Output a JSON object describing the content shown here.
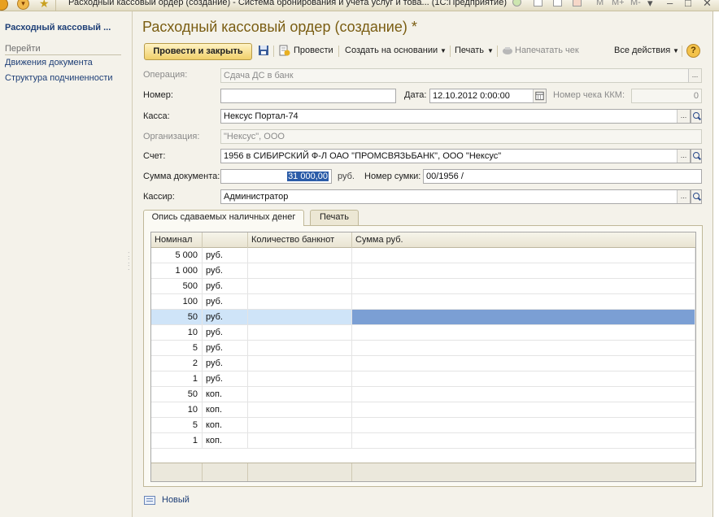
{
  "window": {
    "title": "Расходный кассовый ордер (создание) - Система бронирования и учета услуг и това... (1С:Предприятие)",
    "tool_letters": [
      "M",
      "M+",
      "M-"
    ]
  },
  "nav": {
    "title": "Расходный кассовый ...",
    "group": "Перейти",
    "links": [
      "Движения документа",
      "Структура подчиненности"
    ]
  },
  "form": {
    "title": "Расходный кассовый ордер (создание) *"
  },
  "toolbar": {
    "post_close": "Провести и закрыть",
    "post": "Провести",
    "create_based": "Создать на основании",
    "print": "Печать",
    "print_receipt": "Напечатать чек",
    "all_actions": "Все действия",
    "help": "?"
  },
  "fields": {
    "operation_label": "Операция:",
    "operation_value": "Сдача ДС в банк",
    "number_label": "Номер:",
    "number_value": "",
    "date_label": "Дата:",
    "date_value": "12.10.2012  0:00:00",
    "kkm_label": "Номер чека ККМ:",
    "kkm_value": "0",
    "kassa_label": "Касса:",
    "kassa_value": "Нексус Портал-74",
    "org_label": "Организация:",
    "org_value": "\"Нексус\", ООО",
    "account_label": "Счет:",
    "account_value": "1956 в СИБИРСКИЙ Ф-Л ОАО \"ПРОМСВЯЗЬБАНК\", ООО \"Нексус\"",
    "sum_label": "Сумма документа:",
    "sum_value": "31 000,00",
    "currency": "руб.",
    "bag_label": "Номер сумки:",
    "bag_value": "00/1956  /",
    "cashier_label": "Кассир:",
    "cashier_value": "Администратор"
  },
  "tabs": [
    "Опись сдаваемых наличных денег",
    "Печать"
  ],
  "table": {
    "headers": [
      "Номинал",
      "",
      "Количество банкнот",
      "Сумма руб."
    ],
    "rows": [
      {
        "nominal": "5 000",
        "unit": "руб.",
        "count": "",
        "sum": ""
      },
      {
        "nominal": "1 000",
        "unit": "руб.",
        "count": "",
        "sum": ""
      },
      {
        "nominal": "500",
        "unit": "руб.",
        "count": "",
        "sum": ""
      },
      {
        "nominal": "100",
        "unit": "руб.",
        "count": "",
        "sum": ""
      },
      {
        "nominal": "50",
        "unit": "руб.",
        "count": "",
        "sum": ""
      },
      {
        "nominal": "10",
        "unit": "руб.",
        "count": "",
        "sum": ""
      },
      {
        "nominal": "5",
        "unit": "руб.",
        "count": "",
        "sum": ""
      },
      {
        "nominal": "2",
        "unit": "руб.",
        "count": "",
        "sum": ""
      },
      {
        "nominal": "1",
        "unit": "руб.",
        "count": "",
        "sum": ""
      },
      {
        "nominal": "50",
        "unit": "коп.",
        "count": "",
        "sum": ""
      },
      {
        "nominal": "10",
        "unit": "коп.",
        "count": "",
        "sum": ""
      },
      {
        "nominal": "5",
        "unit": "коп.",
        "count": "",
        "sum": ""
      },
      {
        "nominal": "1",
        "unit": "коп.",
        "count": "",
        "sum": ""
      }
    ],
    "selected_row": 4
  },
  "bottom": {
    "new_label": "Новый"
  },
  "colors": {
    "title": "#7a5d12",
    "link": "#1d3e76",
    "primary_button": "#f0cf6a",
    "selected_row": "#cfe4f8",
    "selected_cell": "#7b9fd4"
  }
}
